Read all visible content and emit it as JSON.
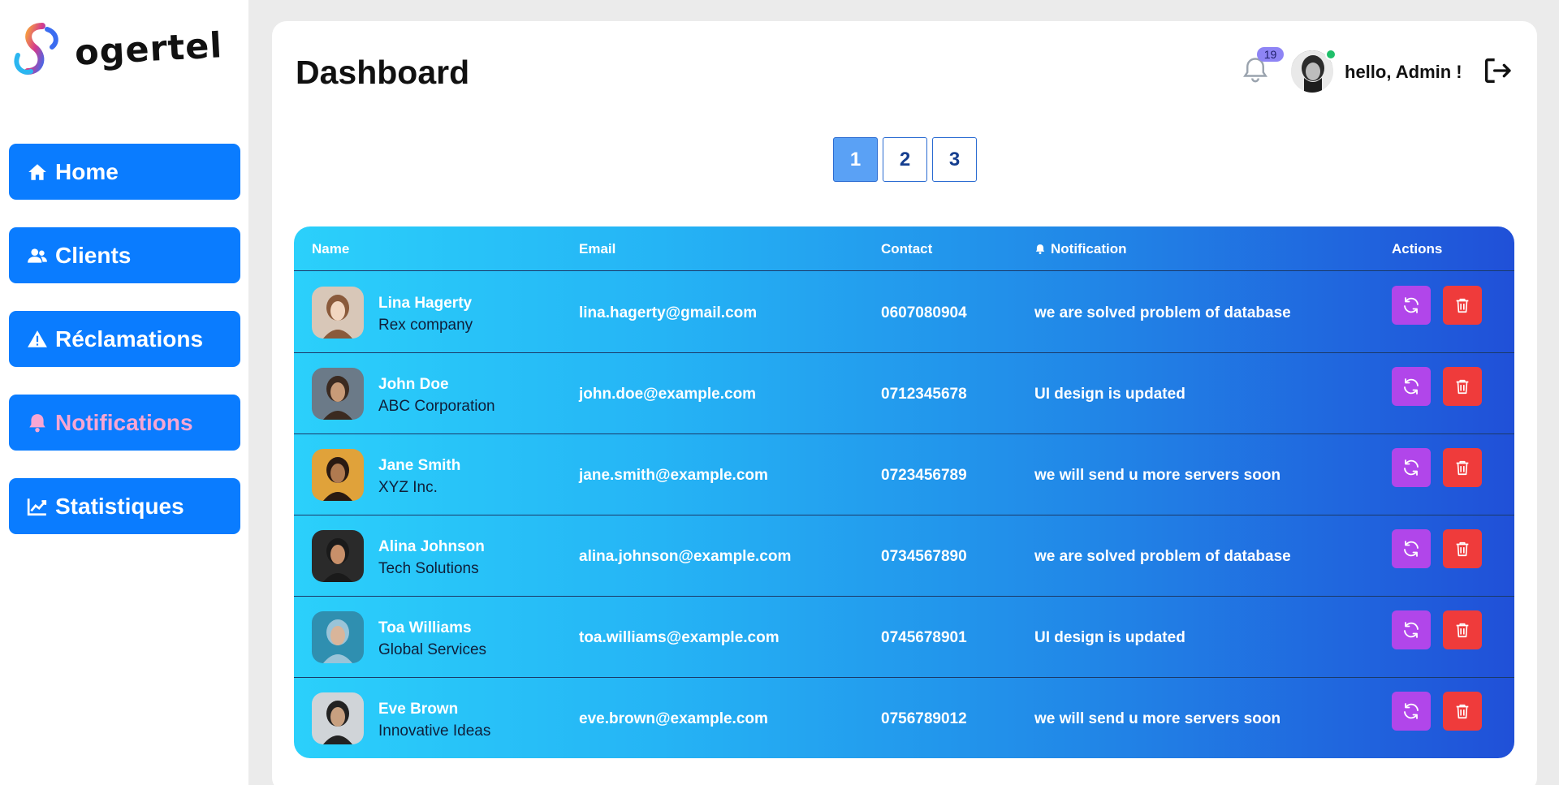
{
  "brand": {
    "name": "ogertel"
  },
  "sidebar": {
    "items": [
      {
        "label": "Home",
        "icon": "home-icon",
        "active": false
      },
      {
        "label": "Clients",
        "icon": "users-icon",
        "active": false
      },
      {
        "label": "Réclamations",
        "icon": "warning-icon",
        "active": false
      },
      {
        "label": "Notifications",
        "icon": "bell-icon",
        "active": true
      },
      {
        "label": "Statistiques",
        "icon": "chart-line-icon",
        "active": false
      }
    ]
  },
  "header": {
    "title": "Dashboard",
    "notification_count": "19",
    "greeting": "hello, Admin !"
  },
  "pagination": {
    "pages": [
      "1",
      "2",
      "3"
    ],
    "current": "1"
  },
  "table": {
    "columns": [
      "Name",
      "Email",
      "Contact",
      "Notification",
      "Actions"
    ],
    "rows": [
      {
        "name": "Lina Hagerty",
        "company": "Rex company",
        "email": "lina.hagerty@gmail.com",
        "contact": "0607080904",
        "notification": "we are solved problem of database"
      },
      {
        "name": "John Doe",
        "company": "ABC Corporation",
        "email": "john.doe@example.com",
        "contact": "0712345678",
        "notification": "UI design is updated"
      },
      {
        "name": "Jane Smith",
        "company": "XYZ Inc.",
        "email": "jane.smith@example.com",
        "contact": "0723456789",
        "notification": "we will send u more servers soon"
      },
      {
        "name": "Alina Johnson",
        "company": "Tech Solutions",
        "email": "alina.johnson@example.com",
        "contact": "0734567890",
        "notification": "we are solved problem of database"
      },
      {
        "name": "Toa Williams",
        "company": "Global Services",
        "email": "toa.williams@example.com",
        "contact": "0745678901",
        "notification": "UI design is updated"
      },
      {
        "name": "Eve Brown",
        "company": "Innovative Ideas",
        "email": "eve.brown@example.com",
        "contact": "0756789012",
        "notification": "we will send u more servers soon"
      }
    ]
  },
  "colors": {
    "nav_bg": "#0a7cff",
    "nav_active_text": "#f7a6d3",
    "refresh_button": "#b146ea",
    "delete_button": "#ef3b3b",
    "table_gradient_start": "#2bd0fb",
    "table_gradient_end": "#2050d8"
  }
}
